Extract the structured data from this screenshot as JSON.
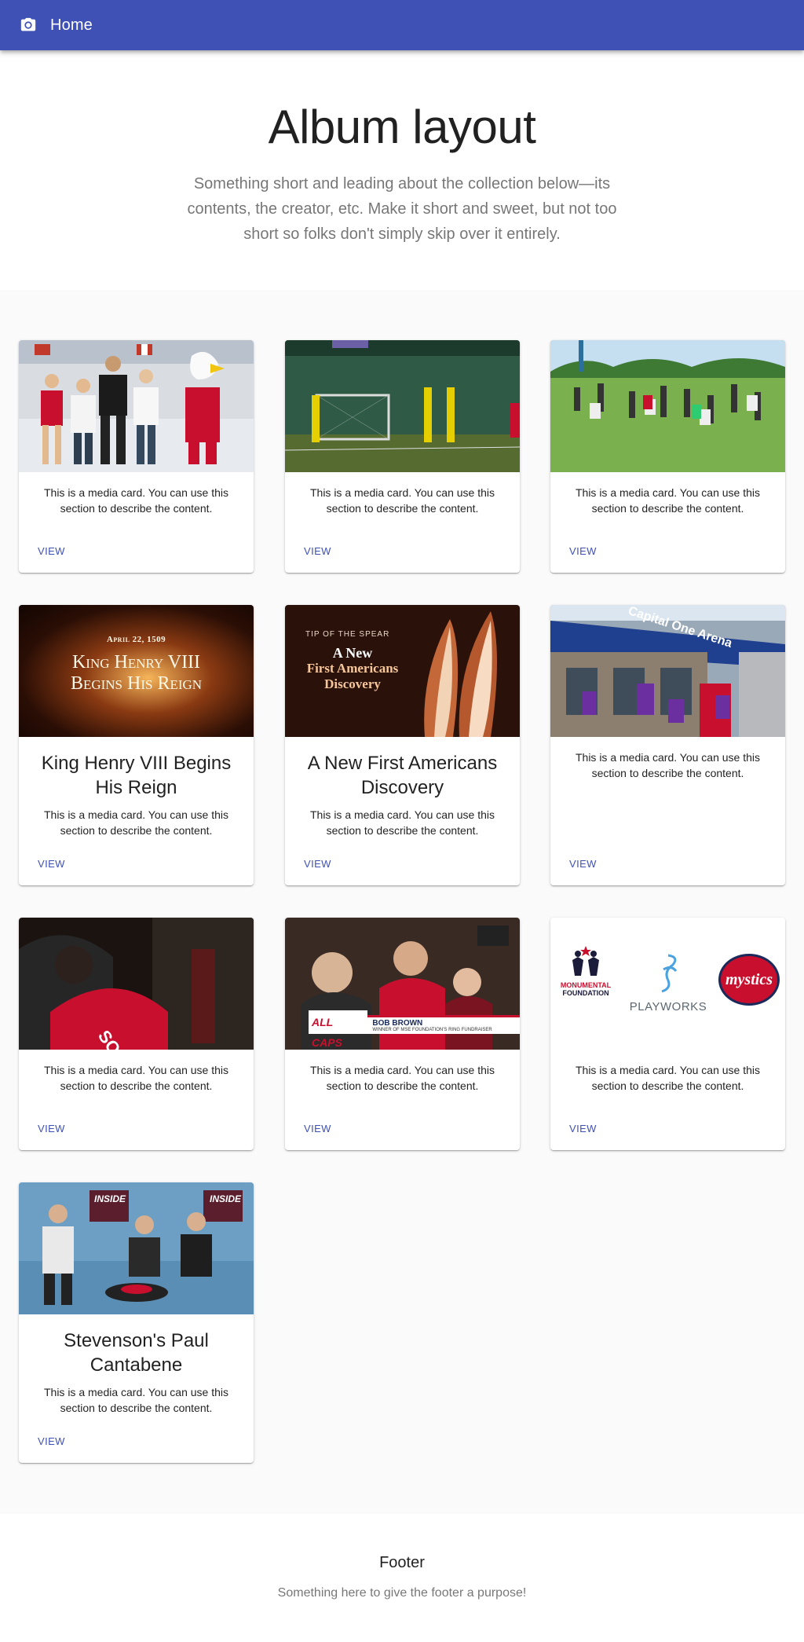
{
  "appbar": {
    "title": "Home",
    "icon": "camera-icon",
    "color": "#3f51b5"
  },
  "hero": {
    "title": "Album layout",
    "description": "Something short and leading about the collection below—its contents, the creator, etc. Make it short and sweet, but not too short so folks don't simply skip over it entirely."
  },
  "cards": [
    {
      "title": "",
      "text": "This is a media card. You can use this section to describe the content.",
      "action": "View",
      "media": "hockey-rink-group-photo"
    },
    {
      "title": "",
      "text": "This is a media card. You can use this section to describe the content.",
      "action": "View",
      "media": "indoor-soccer-goal"
    },
    {
      "title": "",
      "text": "This is a media card. You can use this section to describe the content.",
      "action": "View",
      "media": "kids-on-grass-field"
    },
    {
      "title": "King Henry VIII Begins His Reign",
      "text": "This is a media card. You can use this section to describe the content.",
      "action": "View",
      "media": "king-henry-title-card",
      "media_text": {
        "date": "April 22, 1509",
        "line1": "King Henry VIII",
        "line2": "Begins His Reign"
      }
    },
    {
      "title": "A New First Americans Discovery",
      "text": "This is a media card. You can use this section to describe the content.",
      "action": "View",
      "media": "spear-points-title-card",
      "media_text": {
        "kicker": "TIP OF THE SPEAR",
        "line1": "A New",
        "line2": "First Americans",
        "line3": "Discovery"
      }
    },
    {
      "title": "",
      "text": "This is a media card. You can use this section to describe the content.",
      "action": "View",
      "media": "capital-one-arena-kids",
      "media_text": {
        "sign": "Capital One Arena"
      }
    },
    {
      "title": "",
      "text": "This is a media card. You can use this section to describe the content.",
      "action": "View",
      "media": "jersey-signing"
    },
    {
      "title": "",
      "text": "This is a media card. You can use this section to describe the content.",
      "action": "View",
      "media": "all-caps-fans",
      "media_text": {
        "badge": "ALL CAPS",
        "name": "BOB BROWN",
        "sub": "WINNER OF MSE FOUNDATION'S RING FUNDRAISER"
      }
    },
    {
      "title": "",
      "text": "This is a media card. You can use this section to describe the content.",
      "action": "View",
      "media": "partner-logos",
      "media_text": {
        "logo1": "MONUMENTAL",
        "logo1b": "FOUNDATION",
        "logo2": "PLAYWORKS",
        "logo3": "mystics"
      }
    },
    {
      "title": "Stevenson's Paul Cantabene",
      "text": "This is a media card. You can use this section to describe the content.",
      "action": "View",
      "media": "studio-interview",
      "media_text": {
        "banner": "INSIDE"
      }
    }
  ],
  "footer": {
    "title": "Footer",
    "subtitle": "Something here to give the footer a purpose!"
  }
}
